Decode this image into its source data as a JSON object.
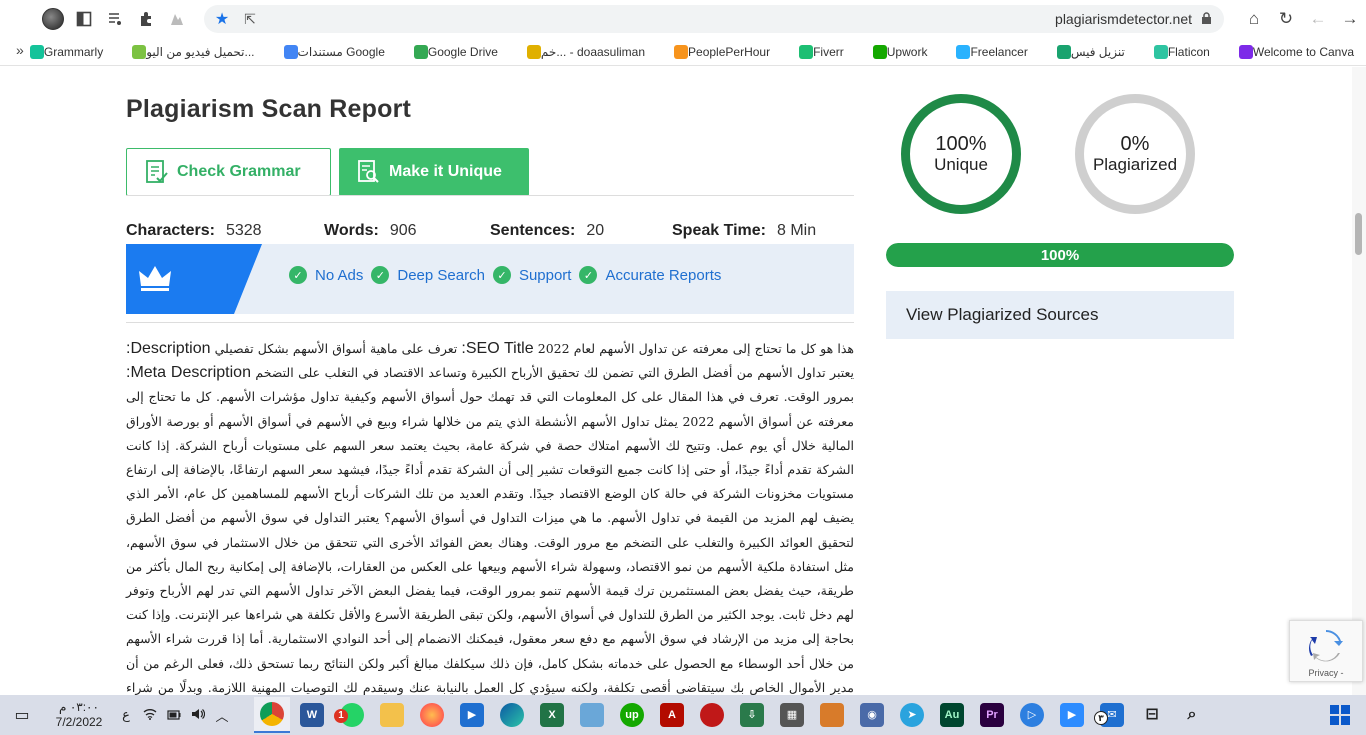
{
  "browser": {
    "url": "plagiarismdetector.net",
    "bookmarks": [
      {
        "label": "Welcome to Canva",
        "color": "#7d2ae8"
      },
      {
        "label": "Flaticon",
        "color": "#2ec4a1"
      },
      {
        "label": "تنزيل فيس",
        "color": "#1aa36f"
      },
      {
        "label": "Freelancer",
        "color": "#29b2fe"
      },
      {
        "label": "Upwork",
        "color": "#14a800"
      },
      {
        "label": "Fiverr",
        "color": "#1dbf73"
      },
      {
        "label": "PeoplePerHour",
        "color": "#f7941d"
      },
      {
        "label": "خم... - doaasuliman",
        "color": "#e0b000"
      },
      {
        "label": "Google Drive",
        "color": "#34a853"
      },
      {
        "label": "مستندات Google",
        "color": "#4285f4"
      },
      {
        "label": "تحميل فيديو من اليو...",
        "color": "#7cc242"
      },
      {
        "label": "Grammarly",
        "color": "#15c39a"
      }
    ],
    "more_label": "»"
  },
  "page": {
    "title": "Plagiarism Scan Report",
    "check_grammar_label": "Check Grammar",
    "make_unique_label": "Make it Unique",
    "stats": {
      "characters_label": "Characters:",
      "characters_value": "5328",
      "words_label": "Words:",
      "words_value": "906",
      "sentences_label": "Sentences:",
      "sentences_value": "20",
      "speak_label": "Speak Time:",
      "speak_value": "8 Min"
    },
    "features": [
      "No Ads",
      "Deep Search",
      "Support",
      "Accurate Reports"
    ],
    "report_intro_1": "هذا هو كل ما تحتاج إلى معرفته عن تداول الأسهم لعام 2022 ",
    "report_en_1": "SEO Title:",
    "report_intro_2": " تعرف على ماهية أسواق الأسهم بشكل تفصيلي ",
    "report_en_2": "Description:",
    "report_intro_3": " يعتبر تداول الأسهم من أفضل الطرق التي تضمن لك تحقيق الأرباح الكبيرة وتساعد الاقتصاد في التغلب على التضخم ",
    "report_en_3": "Meta Description:",
    "report_body": " بمرور الوقت. تعرف في هذا المقال على كل المعلومات التي قد تهمك حول أسواق الأسهم وكيفية تداول مؤشرات الأسهم. كل ما تحتاج إلى معرفته عن أسواق الأسهم 2022 يمثل تداول الأسهم الأنشطة الذي يتم من خلالها شراء وبيع في الأسهم في أسواق الأسهم أو بورصة الأوراق المالية خلال أي يوم عمل. وتتيح لك الأسهم امتلاك حصة في شركة عامة، بحيث يعتمد سعر السهم على مستويات أرباح الشركة. إذا كانت الشركة تقدم أداءً جيدًا، أو حتى إذا كانت جميع التوقعات تشير إلى أن الشركة تقدم أداءً جيدًا، فيشهد سعر السهم ارتفاعًا، بالإضافة إلى ارتفاع مستويات مخزونات الشركة في حالة كان الوضع الاقتصاد جيدًا. وتقدم العديد من تلك الشركات أرباح الأسهم للمساهمين كل عام، الأمر الذي يضيف لهم المزيد من القيمة في تداول الأسهم. ما هي ميزات التداول في أسواق الأسهم؟ يعتبر التداول في سوق الأسهم من أفضل الطرق لتحقيق العوائد الكبيرة والتغلب على التضخم مع مرور الوقت. وهناك بعض الفوائد الأخرى التي تتحقق من خلال الاستثمار في سوق الأسهم، مثل استفادة ملكية الأسهم من نمو الاقتصاد، وسهولة شراء الأسهم وبيعها على العكس من العقارات، بالإضافة إلى إمكانية ربح المال بأكثر من طريقة، حيث يفضل بعض المستثمرين ترك قيمة الأسهم تنمو بمرور الوقت، فيما يفضل البعض الآخر تداول الأسهم التي تدر لهم الأرباح وتوفر لهم دخل ثابت. يوجد الكثير من الطرق للتداول في أسواق الأسهم، ولكن تبقى الطريقة الأسرع والأقل تكلفة هي شراءها عبر الإنترنت. وإذا كنت بحاجة إلى مزيد من الإرشاد في سوق الأسهم مع دفع سعر معقول، فيمكنك الانضمام إلى أحد النوادي الاستثمارية. أما إذا قررت شراء الأسهم من خلال أحد الوسطاء مع الحصول على خدماته بشكل كامل، فإن ذلك سيكلفك مبالغ أكبر ولكن النتائج ربما تستحق ذلك، فعلى الرغم من أن مدير الأموال الخاص بك سيتقاضى أقصى تكلفة، ولكنه سيؤدي كل العمل بالنيابة عنك وسيقدم لك التوصيات المهنية اللازمة. وبدلًا من شراء الأسهم الفردية،",
    "unique_pct": "100%",
    "unique_label": "Unique",
    "plag_pct": "0%",
    "plag_label": "Plagiarized",
    "progress_value": 100,
    "progress_label": "100%",
    "view_sources_label": "View Plagiarized Sources",
    "recaptcha_label": "Privacy -"
  },
  "taskbar": {
    "time": "٠٣:٠٠ م",
    "date": "7/2/2022",
    "lang": "ع",
    "badge_whatsapp": "1",
    "badge_mail": "٣"
  },
  "colors": {
    "accent_green": "#3dbf6d",
    "ring_green": "#1f8a47",
    "banner_blue": "#1b7bf0"
  }
}
